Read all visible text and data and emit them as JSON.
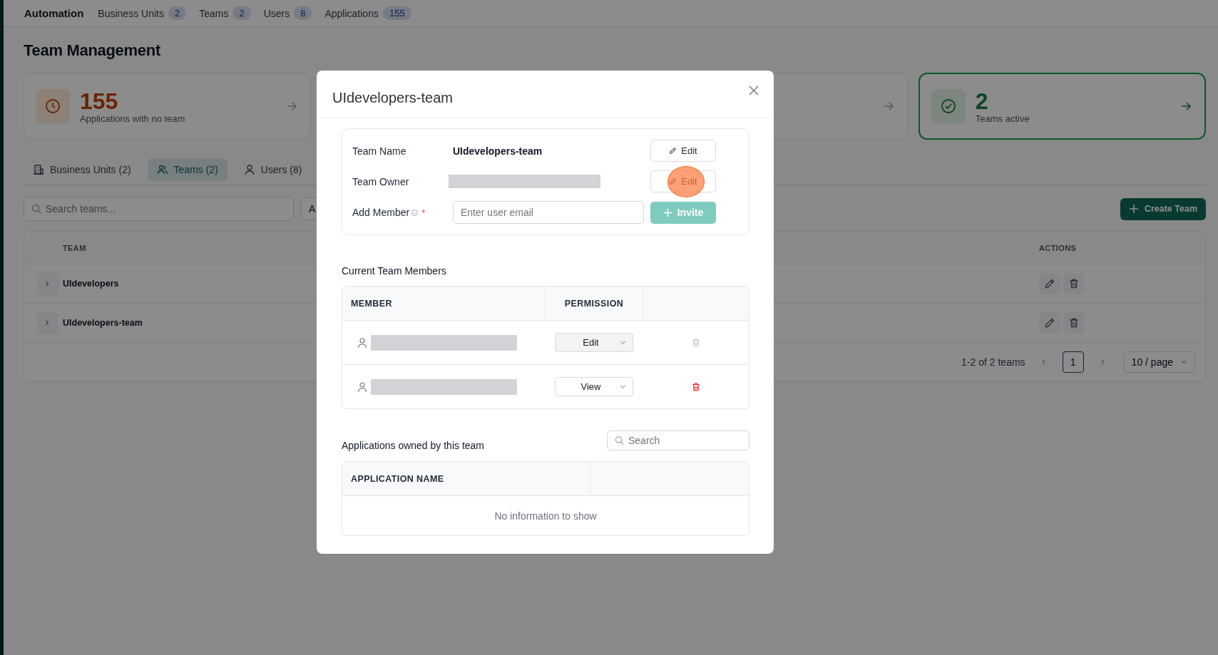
{
  "nav": {
    "brand": "Automation",
    "items": [
      {
        "label": "Business Units",
        "count": "2"
      },
      {
        "label": "Teams",
        "count": "2"
      },
      {
        "label": "Users",
        "count": "8"
      },
      {
        "label": "Applications",
        "count": "155"
      }
    ]
  },
  "page_title": "Team Management",
  "stat_cards": [
    {
      "kind": "warning",
      "value": "155",
      "label": "Applications with no team",
      "highlighted": false
    },
    {
      "kind": "success",
      "value": "2",
      "label": "Teams active",
      "highlighted": true
    }
  ],
  "tabs": [
    {
      "kind": "building",
      "label": "Business Units (2)",
      "selected": false
    },
    {
      "kind": "group",
      "label": "Teams (2)",
      "selected": true
    },
    {
      "kind": "user",
      "label": "Users (8)",
      "selected": false
    }
  ],
  "search": {
    "placeholder": "Search teams..."
  },
  "filter": {
    "value": "A"
  },
  "create_button": "Create Team",
  "table": {
    "columns": [
      "TEAM",
      "ACTIONS"
    ],
    "rows": [
      {
        "name": "UIdevelopers"
      },
      {
        "name": "UIdevelopers-team"
      }
    ]
  },
  "pagination": {
    "summary": "1-2 of 2 teams",
    "pages": [
      {
        "label": "1",
        "selected": true
      }
    ],
    "page_size": "10 / page"
  },
  "modal": {
    "title": "UIdevelopers-team",
    "fields": [
      {
        "kind": "text",
        "label": "Team Name",
        "value": "UIdevelopers-team",
        "action": "Edit",
        "action_highlighted": false
      },
      {
        "kind": "redacted",
        "label": "Team Owner",
        "action": "Edit",
        "action_highlighted": true
      },
      {
        "kind": "input",
        "label": "Add Member",
        "required_mark": "*",
        "placeholder": "Enter user email",
        "action": "Invite",
        "action_disabled": true
      }
    ],
    "members_title": "Current Team Members",
    "members_columns": [
      "MEMBER",
      "PERMISSION"
    ],
    "members": [
      {
        "permission": "Edit",
        "disabled": true
      },
      {
        "permission": "View",
        "disabled": false
      }
    ],
    "apps_title": "Applications owned by this team",
    "apps_search": {
      "placeholder": "Search"
    },
    "apps_columns": [
      "APPLICATION NAME"
    ],
    "apps_empty": "No information to show"
  }
}
